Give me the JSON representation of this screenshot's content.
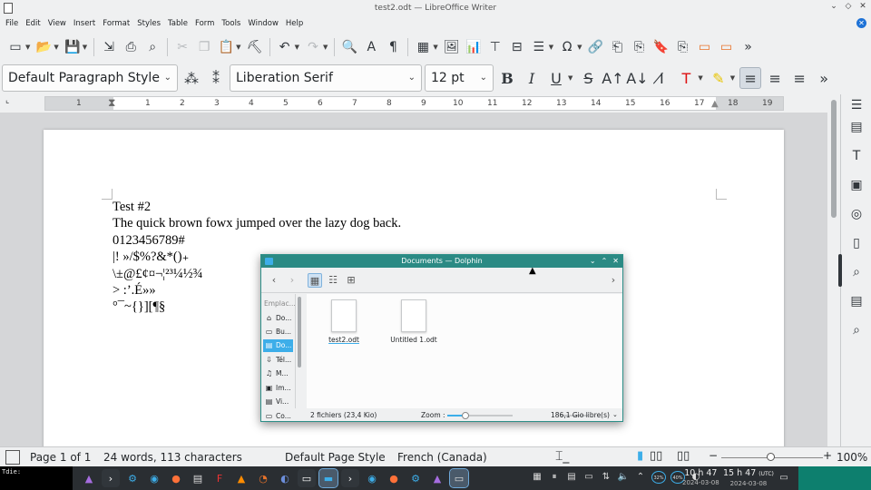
{
  "window": {
    "title": "test2.odt — LibreOffice Writer",
    "controls": [
      "⌄",
      "◇",
      "✕"
    ]
  },
  "menubar": [
    "File",
    "Edit",
    "View",
    "Insert",
    "Format",
    "Styles",
    "Table",
    "Form",
    "Tools",
    "Window",
    "Help"
  ],
  "formatting": {
    "paragraph_style": "Default Paragraph Style",
    "font_name": "Liberation Serif",
    "font_size": "12 pt",
    "bold": "B",
    "italic": "I",
    "underline": "U"
  },
  "ruler": {
    "ticks": [
      "1",
      "1",
      "2",
      "3",
      "4",
      "5",
      "6",
      "7",
      "8",
      "9",
      "10",
      "11",
      "12",
      "13",
      "14",
      "15",
      "16",
      "17",
      "18",
      "19"
    ]
  },
  "document": {
    "lines": [
      "Test #2",
      "",
      "The quick brown fowx jumped over the lazy dog back.",
      "0123456789#",
      "|! »/$%?&*()₊",
      "\\±@£¢¤¬¦²³¼½¾",
      "> :’.É»»",
      "°¯~{}][¶§"
    ]
  },
  "statusbar": {
    "page": "Page 1 of 1",
    "words": "24 words, 113 characters",
    "page_style": "Default Page Style",
    "language": "French (Canada)",
    "zoom": "100%"
  },
  "dolphin": {
    "title": "Documents — Dolphin",
    "places_header": "Emplac...",
    "places": [
      {
        "label": "Do...",
        "icon": "home-icon",
        "active": false
      },
      {
        "label": "Bu...",
        "icon": "desktop-icon",
        "active": false
      },
      {
        "label": "Do...",
        "icon": "documents-icon",
        "active": true
      },
      {
        "label": "Tél...",
        "icon": "downloads-icon",
        "active": false
      },
      {
        "label": "M...",
        "icon": "music-icon",
        "active": false
      },
      {
        "label": "Im...",
        "icon": "pictures-icon",
        "active": false
      },
      {
        "label": "Vi...",
        "icon": "videos-icon",
        "active": false
      },
      {
        "label": "Co...",
        "icon": "computer-icon",
        "active": false
      }
    ],
    "files": [
      {
        "name": "test2.odt"
      },
      {
        "name": "Untitled 1.odt"
      }
    ],
    "status_count": "2 fichiers (23,4 Kio)",
    "zoom_label": "Zoom :",
    "zoom_level": 0.28,
    "free_space": "186,1 Gio libre(s)"
  },
  "taskbar": {
    "terminal_preview": "Tdie:",
    "clock1_time": "10 h 47",
    "clock1_date": "2024-03-08",
    "clock2_time": "15 h 47",
    "clock2_tz": "(UTC)",
    "clock2_date": "2024-03-08",
    "cpu1": "32%",
    "cpu2": "40%"
  }
}
